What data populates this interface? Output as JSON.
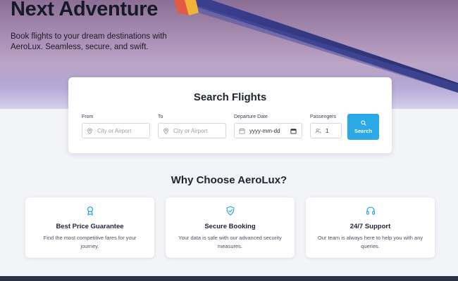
{
  "hero": {
    "title": "Next Adventure",
    "subtitle": "Book flights to your dream destinations with AeroLux. Seamless, secure, and swift."
  },
  "search": {
    "title": "Search Flights",
    "from_label": "From",
    "from_placeholder": "City or Airport",
    "to_label": "To",
    "to_placeholder": "City or Airport",
    "date_label": "Departure Date",
    "date_placeholder": "yyyy-mm-dd",
    "passengers_label": "Passengers",
    "passengers_value": "1",
    "button_label": "Search",
    "button_color": "#2ba8e6"
  },
  "why": {
    "title": "Why Choose AeroLux?",
    "features": [
      {
        "icon": "award-icon",
        "title": "Best Price Guarantee",
        "desc": "Find the most competitive fares for your journey."
      },
      {
        "icon": "shield-check-icon",
        "title": "Secure Booking",
        "desc": "Your data is safe with our advanced security measures."
      },
      {
        "icon": "headphones-icon",
        "title": "24/7 Support",
        "desc": "Our team is always here to help you with any queries."
      }
    ]
  },
  "colors": {
    "accent": "#2ba8e6",
    "icon": "#2ba8e6",
    "background": "#f3f4f7"
  }
}
